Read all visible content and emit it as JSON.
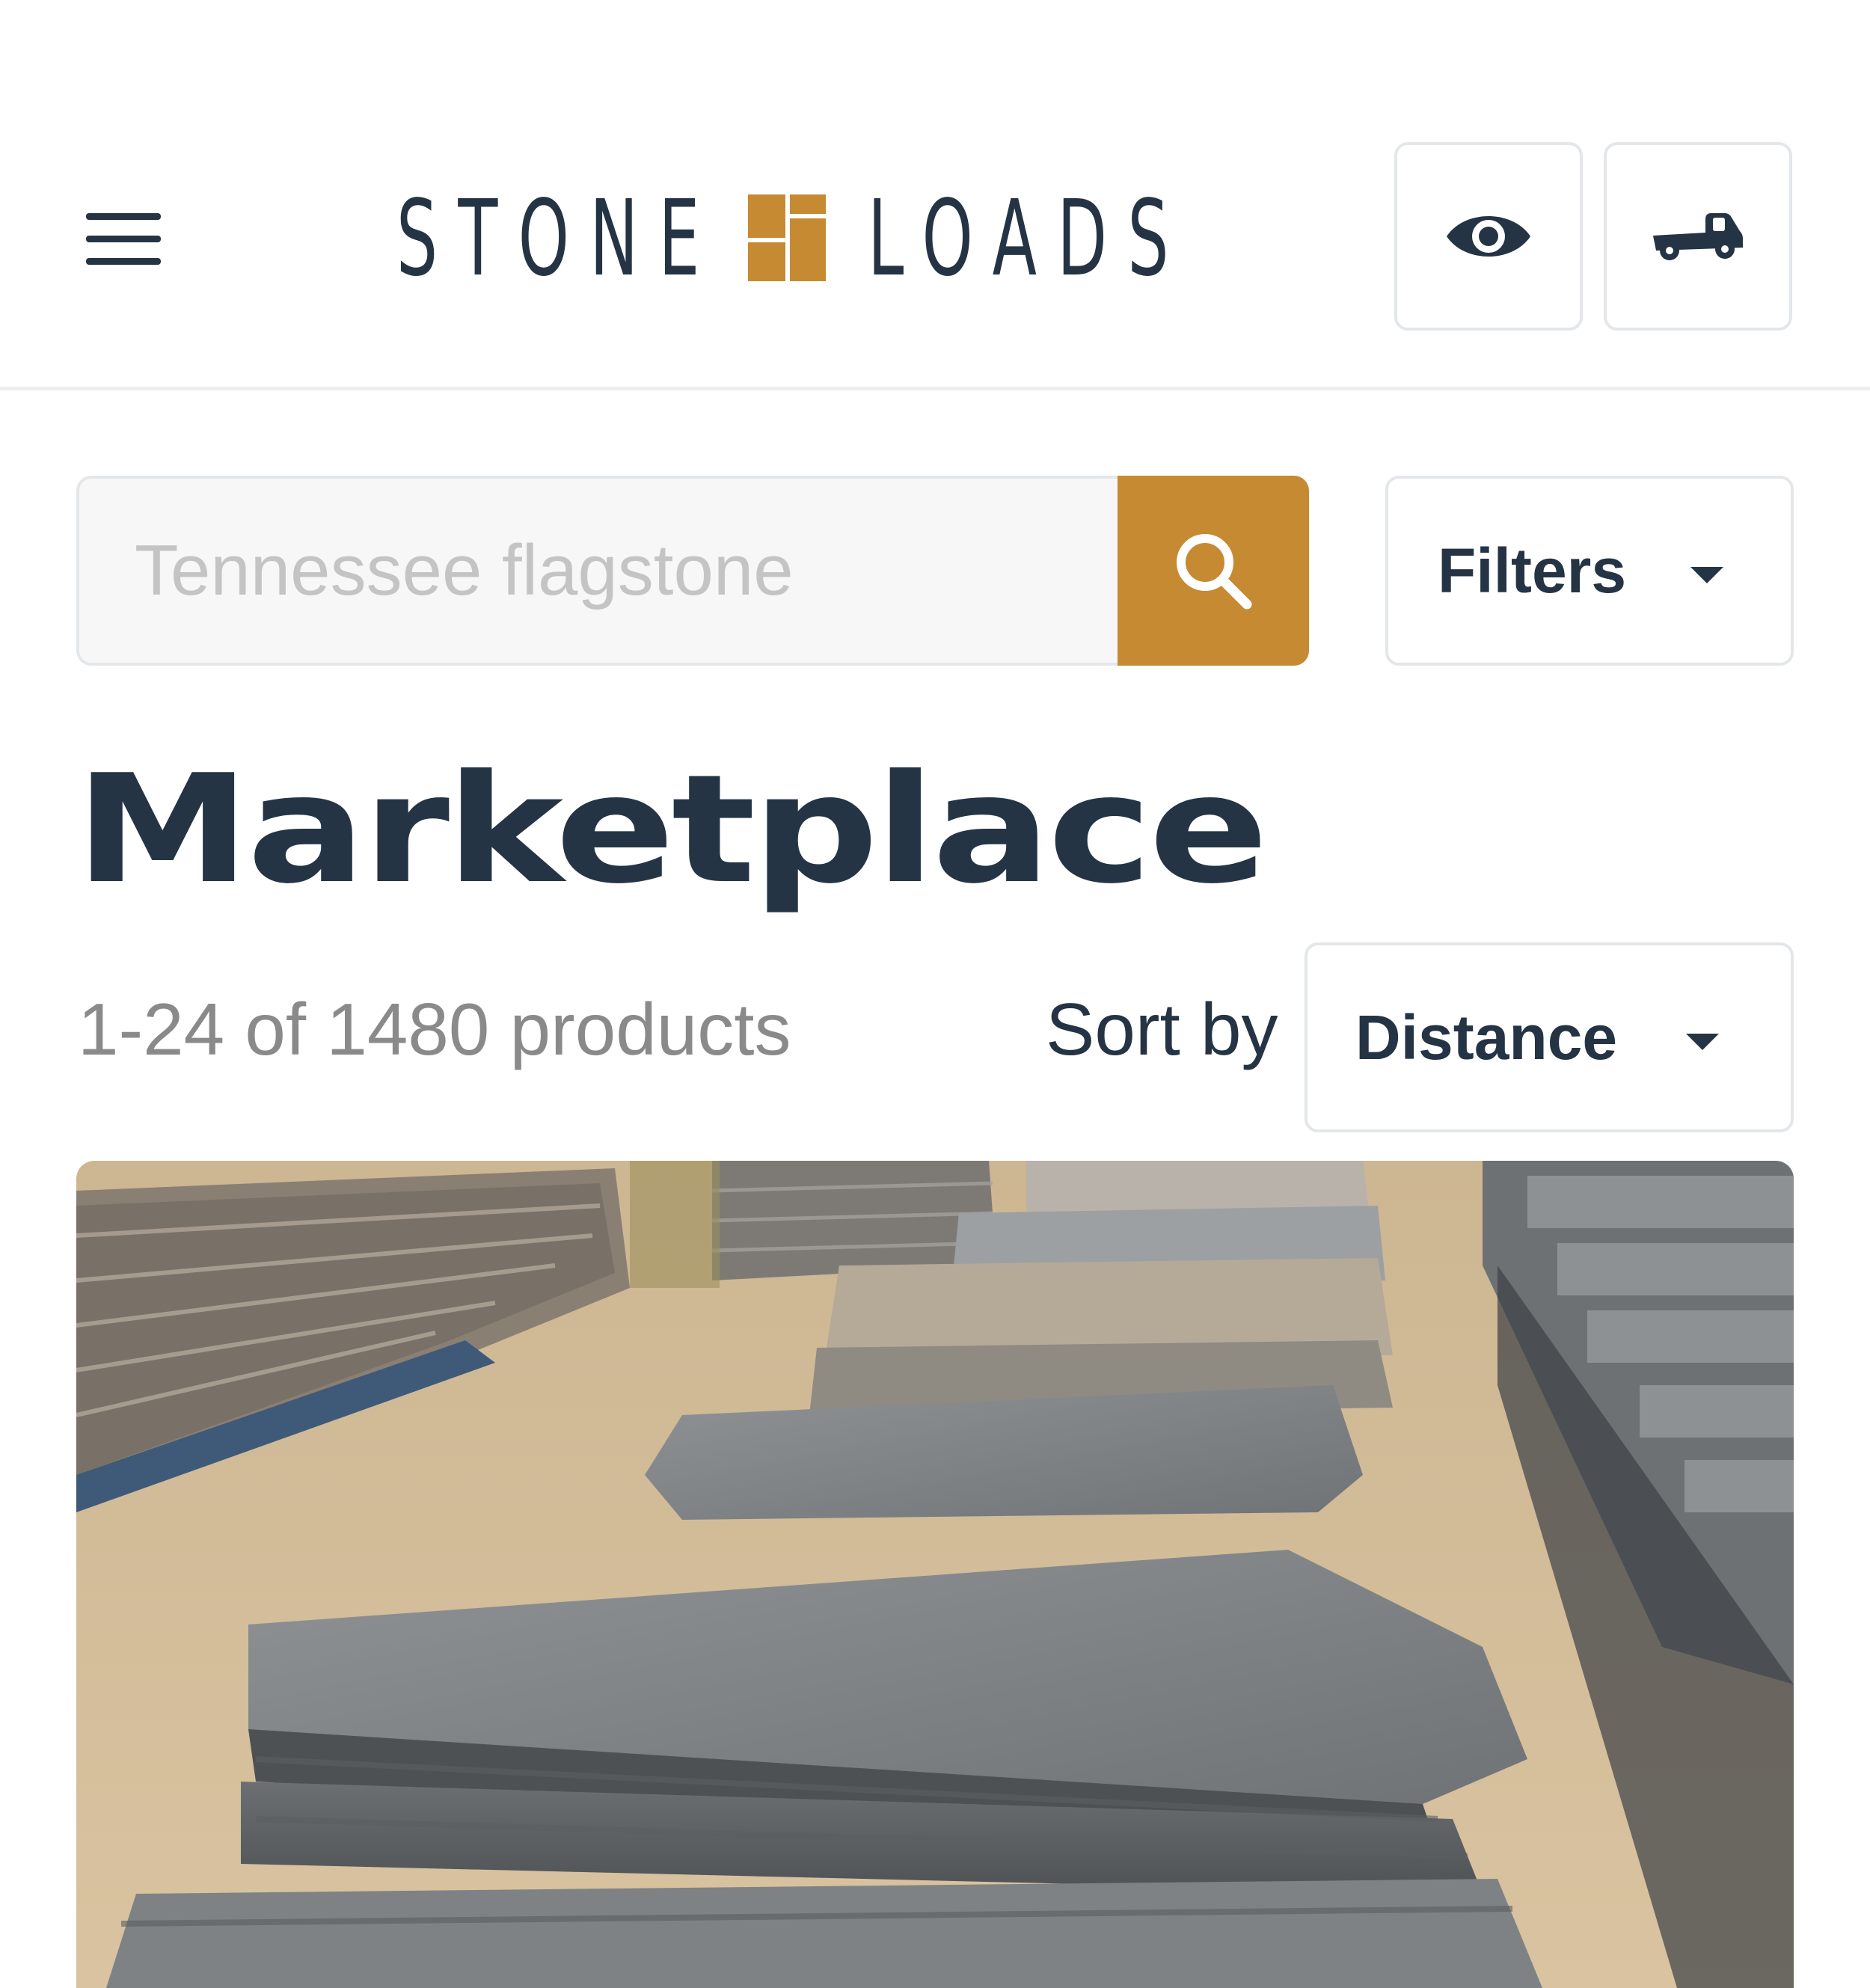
{
  "header": {
    "logo_left": "STONE",
    "logo_right": "LOADS",
    "icons": {
      "menu": "hamburger-menu-icon",
      "watchlist": "eye-icon",
      "delivery": "truck-icon"
    }
  },
  "search": {
    "placeholder": "Tennessee flagstone",
    "value": "",
    "button_icon": "search-icon"
  },
  "filters": {
    "label": "Filters"
  },
  "page": {
    "title": "Marketplace",
    "result_count": "1-24 of 1480 products"
  },
  "sort": {
    "label": "Sort by",
    "selected": "Distance"
  },
  "colors": {
    "brand_navy": "#253444",
    "brand_gold": "#c68a33",
    "muted_text": "#8a8a8a",
    "border": "#e4e7ea"
  },
  "product": {
    "image": "stone-pallets-photo"
  }
}
